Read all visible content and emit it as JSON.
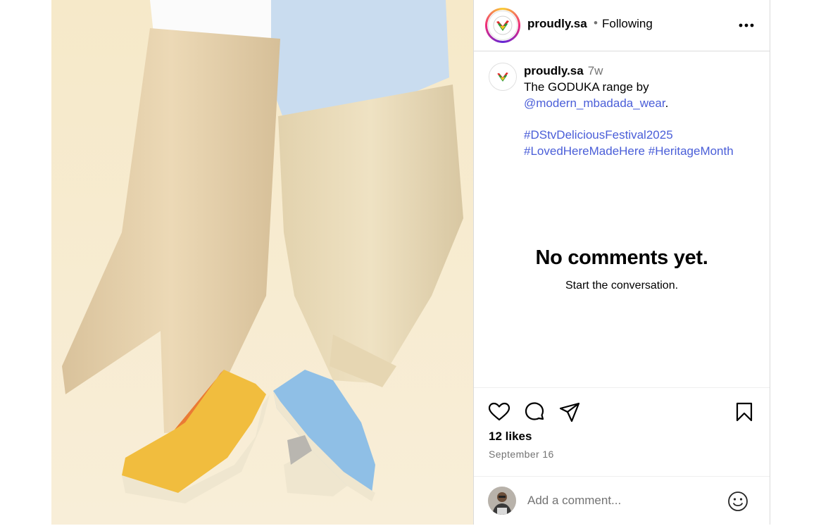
{
  "post": {
    "username": "proudly.sa",
    "dot": "•",
    "follow_status": "Following",
    "caption": {
      "username": "proudly.sa",
      "time_ago": "7w",
      "text_before": "The GODUKA range by",
      "mention": "@modern_mbadada_wear",
      "text_after": ".",
      "hashtag_1": "#DStvDeliciousFestival2025",
      "hashtag_2": "#LovedHereMadeHere",
      "hashtag_3": "#HeritageMonth"
    },
    "empty_state": {
      "title": "No comments yet.",
      "subtitle": "Start the conversation."
    },
    "likes": "12 likes",
    "date": "September 16",
    "comment_placeholder": "Add a comment..."
  },
  "icons": [
    "more-icon",
    "heart-icon",
    "comment-icon",
    "share-icon",
    "bookmark-icon",
    "emoji-icon"
  ],
  "colors": {
    "link": "#4a5ed8",
    "secondary_text": "#737373",
    "border": "#dbdbdb",
    "photo_background": "#f7ecd0"
  }
}
